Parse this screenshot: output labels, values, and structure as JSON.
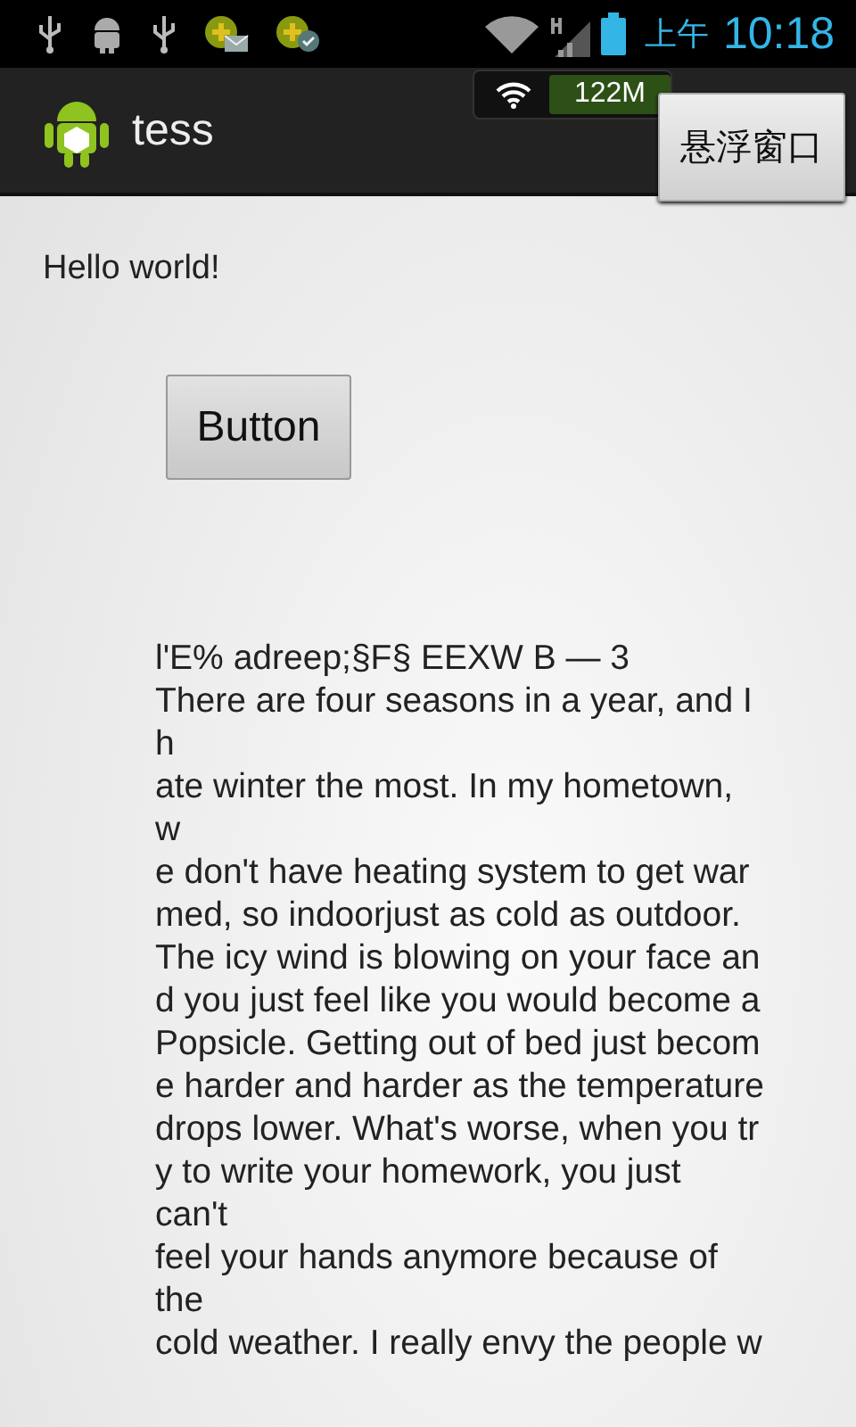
{
  "status_bar": {
    "am_pm": "上午",
    "time": "10:18"
  },
  "app_bar": {
    "title": "tess"
  },
  "float_overlay": {
    "memory": "122M",
    "button": "悬浮窗口"
  },
  "content": {
    "greeting": "Hello world!",
    "button": "Button",
    "ocr_lines": [
      "l'E% adreep;§F§ EEXW B  — 3",
      "There are four seasons in a year, and I",
      "h",
      "ate winter the most. In my hometown,",
      "w",
      "e don't have heating system to get war",
      "med, so indoorjust as cold as outdoor.",
      "The icy wind is blowing on your face an",
      "d you just feel like you would become a",
      "Popsicle. Getting out of bed just becom",
      "e harder and harder as the temperature",
      "drops lower. What's worse, when you tr",
      "y to write your homework, you just",
      "can't",
      "feel your hands anymore because of",
      "the",
      "cold weather. I really envy the people w"
    ]
  }
}
